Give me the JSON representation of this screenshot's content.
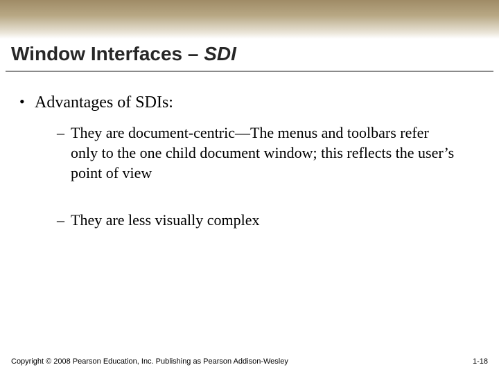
{
  "title": {
    "prefix": "Window Interfaces – ",
    "italic": "SDI"
  },
  "content": {
    "heading": "Advantages of SDIs:",
    "items": [
      "They are document-centric—The menus and toolbars refer only to the one child document window; this reflects the user’s point of view",
      "They are less visually complex"
    ]
  },
  "footer": {
    "copyright": "Copyright © 2008 Pearson Education, Inc. Publishing as Pearson Addison-Wesley",
    "page": "1-18"
  }
}
